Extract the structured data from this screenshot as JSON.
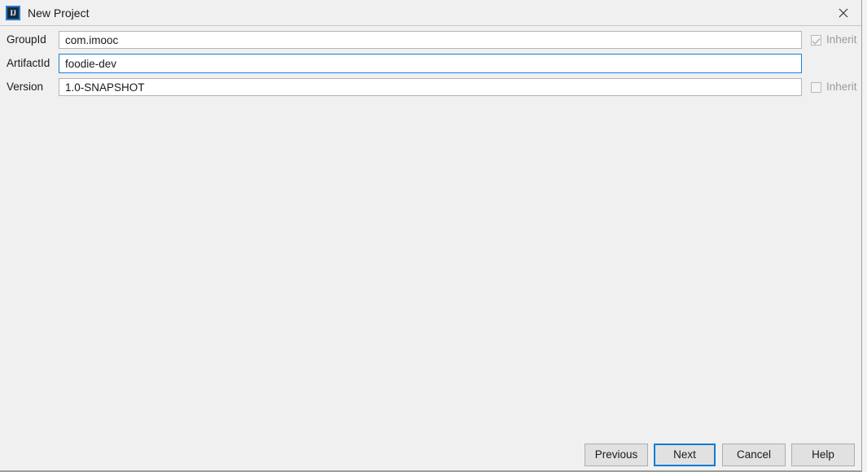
{
  "window": {
    "title": "New Project",
    "app_icon": "intellij-idea-icon",
    "app_icon_text": "IJ",
    "close_icon": "close-icon",
    "accent_color": "#1a7fd4",
    "background_color": "#f0f0f0"
  },
  "form": {
    "rows": [
      {
        "label": "GroupId",
        "value": "com.imooc",
        "focused": false,
        "inherit": {
          "label": "Inherit",
          "checked": true,
          "enabled": false
        }
      },
      {
        "label": "ArtifactId",
        "value": "foodie-dev",
        "focused": true,
        "inherit": null
      },
      {
        "label": "Version",
        "value": "1.0-SNAPSHOT",
        "focused": false,
        "inherit": {
          "label": "Inherit",
          "checked": false,
          "enabled": false
        }
      }
    ]
  },
  "buttons": {
    "previous": "Previous",
    "next": "Next",
    "cancel": "Cancel",
    "help": "Help",
    "default_button": "Next"
  }
}
